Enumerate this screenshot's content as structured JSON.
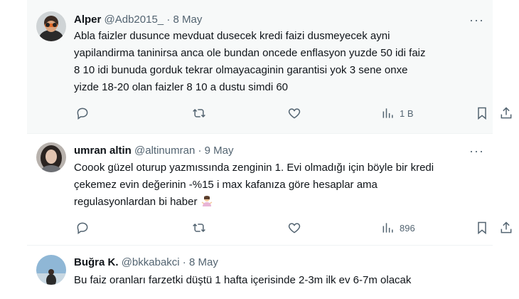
{
  "tweets": [
    {
      "name": "Alper",
      "handle": "@Adb2015_",
      "dot": "·",
      "date": "8 May",
      "more": "···",
      "lines": [
        "Abla faizler dusunce mevduat dusecek kredi faizi dusmeyecek ayni",
        "yapilandirma taninirsa anca ole bundan oncede enflasyon yuzde 50 idi faiz",
        "8 10 idi bunuda gorduk tekrar olmayacaginin garantisi yok 3 sene onxe",
        "yizde 18-20 olan faizler 8 10 a dustu simdi 60"
      ],
      "views": "1 B"
    },
    {
      "name": "umran altin",
      "handle": "@altinumran",
      "dot": "·",
      "date": "9 May",
      "more": "···",
      "lines": [
        "Coook güzel oturup yazmıssında zenginin 1. Evi olmadığı için böyle bir kredi",
        "çekemez evin değerinin -%15 i max kafanıza göre hesaplar ama",
        "regulasyonlardan bi haber"
      ],
      "emoji": "person-shrugging-emoji",
      "views": "896"
    },
    {
      "name": "Buğra K.",
      "handle": "@bkkabakci",
      "dot": "·",
      "date": "8 May",
      "lines": [
        "Bu faiz oranları farzetki düştü 1 hafta içerisinde 2-3m ilk ev 6-7m olacak"
      ]
    }
  ],
  "icons": {
    "reply": "reply-icon",
    "retweet": "retweet-icon",
    "like": "heart-icon",
    "views": "views-icon",
    "bookmark": "bookmark-icon",
    "share": "share-icon"
  },
  "colors": {
    "text": "#0f1419",
    "secondary": "#536471",
    "hover_bg": "#f7f9f9",
    "divider": "#eff3f4"
  }
}
